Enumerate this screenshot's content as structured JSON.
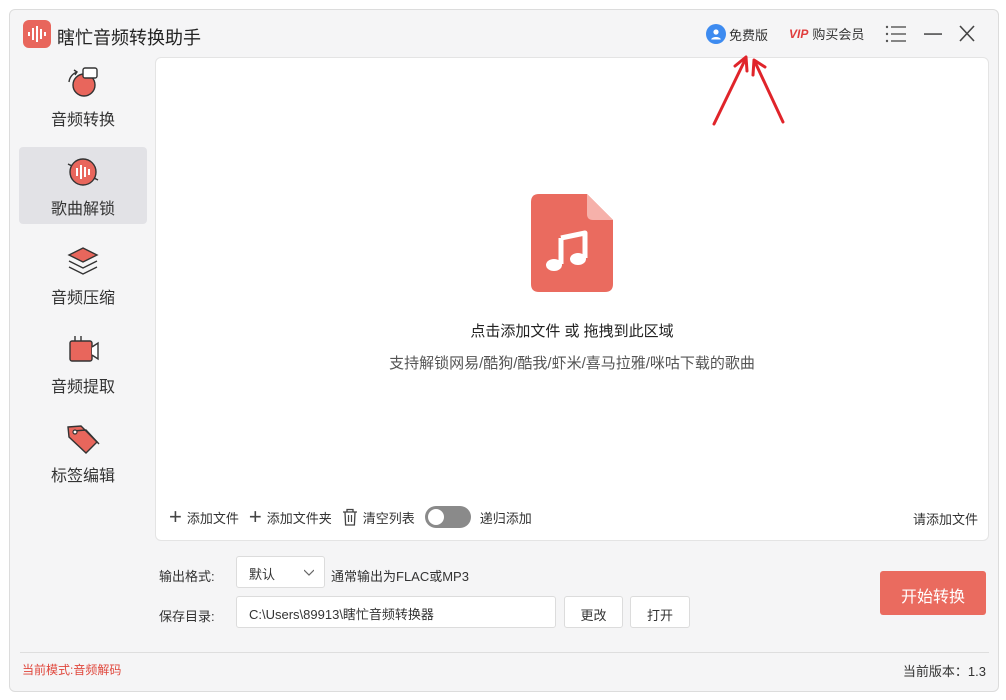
{
  "app": {
    "title": "瞎忙音频转换助手",
    "accent_color": "#ea6b5f"
  },
  "header": {
    "free_label": "免费版",
    "vip_label": "购买会员",
    "vip_icon_text": "VIP"
  },
  "sidebar": {
    "items": [
      {
        "label": "音频转换",
        "icon": "audio-convert-icon",
        "active": false
      },
      {
        "label": "歌曲解锁",
        "icon": "song-unlock-icon",
        "active": true
      },
      {
        "label": "音频压缩",
        "icon": "layers-compress-icon",
        "active": false
      },
      {
        "label": "音频提取",
        "icon": "video-extract-icon",
        "active": false
      },
      {
        "label": "标签编辑",
        "icon": "tag-edit-icon",
        "active": false
      }
    ]
  },
  "dropzone": {
    "title": "点击添加文件 或 拖拽到此区域",
    "subtitle": "支持解锁网易/酷狗/酷我/虾米/喜马拉雅/咪咕下载的歌曲",
    "icon": "music-file-icon"
  },
  "toolbar": {
    "add_file": "添加文件",
    "add_folder": "添加文件夹",
    "clear_list": "清空列表",
    "recursive_add": "递归添加",
    "recursive_enabled": false,
    "status": "请添加文件"
  },
  "settings": {
    "format_label": "输出格式:",
    "format_value": "默认",
    "format_hint": "通常输出为FLAC或MP3",
    "dir_label": "保存目录:",
    "dir_value": "C:\\Users\\89913\\瞎忙音频转换器",
    "change_label": "更改",
    "open_label": "打开",
    "start_label": "开始转换"
  },
  "footer": {
    "mode": "当前模式:音频解码",
    "version": "当前版本：1.3"
  }
}
